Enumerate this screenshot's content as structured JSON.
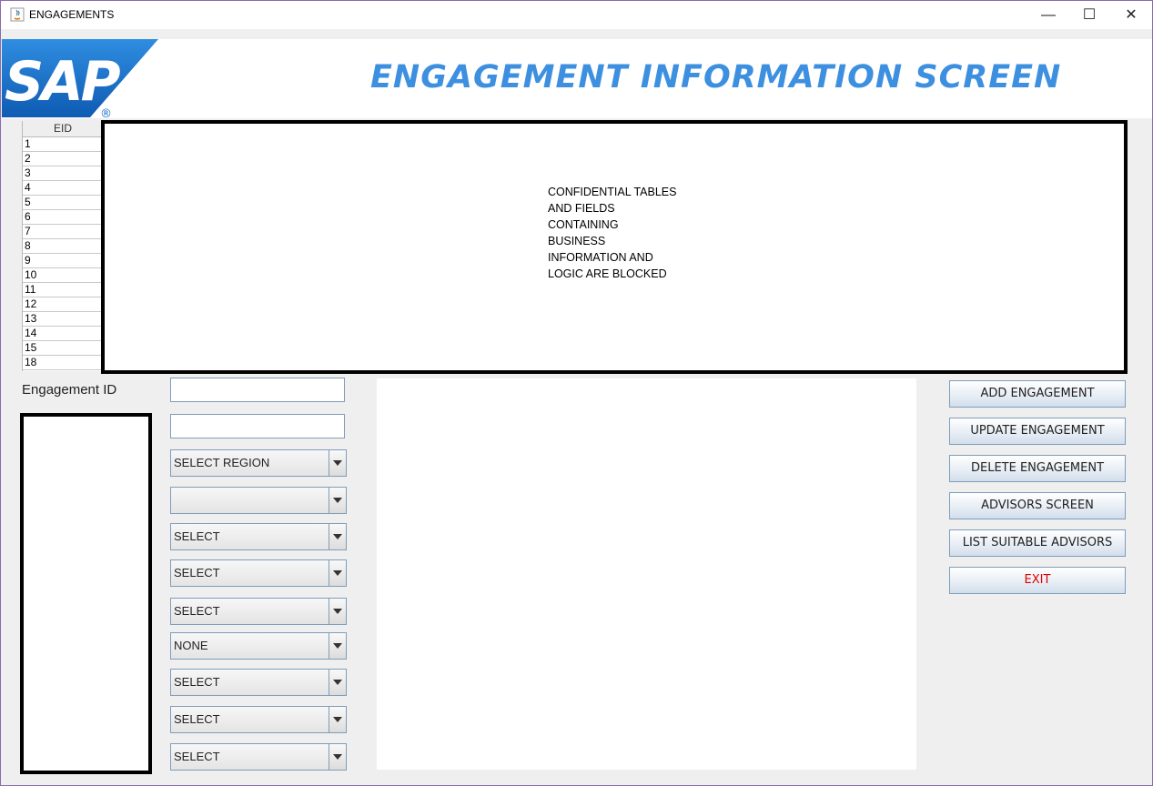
{
  "window": {
    "title": "ENGAGEMENTS",
    "minimize_label": "—",
    "maximize_label": "☐",
    "close_label": "✕"
  },
  "header": {
    "logo_text": "SAP",
    "logo_registered": "®",
    "title": "ENGAGEMENT INFORMATION SCREEN",
    "title_color": "#3d8fe0",
    "logo_color": "#1c6fc6"
  },
  "table": {
    "column_header": "EID",
    "rows": [
      "1",
      "2",
      "3",
      "4",
      "5",
      "6",
      "7",
      "8",
      "9",
      "10",
      "11",
      "12",
      "13",
      "14",
      "15",
      "18"
    ]
  },
  "blocked": {
    "lines": [
      "CONFIDENTIAL TABLES",
      "AND FIELDS",
      "CONTAINING",
      "BUSINESS",
      "INFORMATION AND",
      "LOGIC ARE BLOCKED"
    ]
  },
  "form": {
    "engagement_id_label": "Engagement ID",
    "engagement_id_value": "",
    "second_field_value": "",
    "combos": [
      "SELECT REGION",
      "",
      "SELECT",
      "SELECT",
      "SELECT",
      "NONE",
      "SELECT",
      "SELECT",
      "SELECT"
    ]
  },
  "buttons": {
    "add": "ADD ENGAGEMENT",
    "update": "UPDATE ENGAGEMENT",
    "delete": "DELETE ENGAGEMENT",
    "advisors": "ADVISORS SCREEN",
    "list": "LIST SUITABLE ADVISORS",
    "exit": "EXIT",
    "exit_color": "#e00000"
  }
}
